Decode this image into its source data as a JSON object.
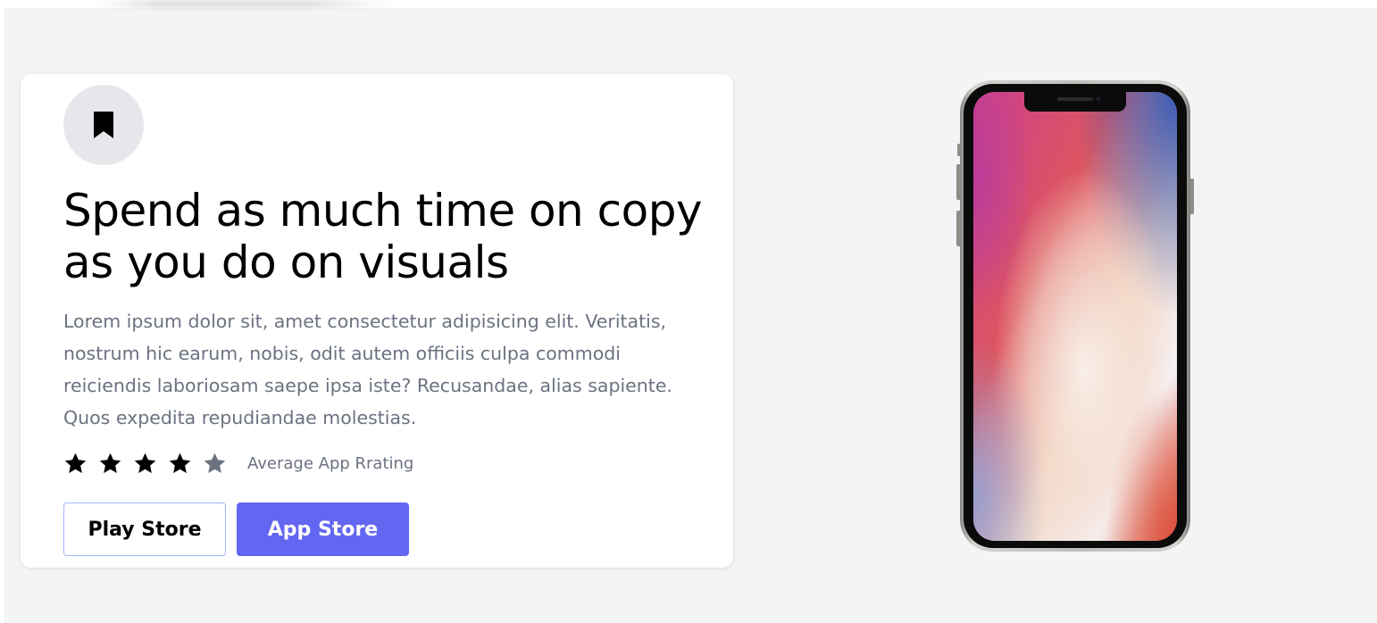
{
  "hero": {
    "headline": "Spend as much time on copy as you do on visuals",
    "description": "Lorem ipsum dolor sit, amet consectetur adipisicing elit. Veritatis, nostrum hic earum, nobis, odit autem officiis culpa commodi reiciendis laboriosam saepe ipsa iste? Recusandae, alias sapiente. Quos expedita repudiandae molestias.",
    "icon": "bookmark-icon"
  },
  "rating": {
    "stars_filled": 4,
    "stars_total": 5,
    "label": "Average App Rrating",
    "filled_color": "#000000",
    "empty_color": "#6b7280"
  },
  "buttons": {
    "play_store": "Play Store",
    "app_store": "App Store"
  },
  "colors": {
    "accent": "#6366f1",
    "page_background": "#f3f4f6",
    "card_background": "#ffffff",
    "muted_text": "#6b7280"
  },
  "device": {
    "name": "phone-mockup"
  }
}
